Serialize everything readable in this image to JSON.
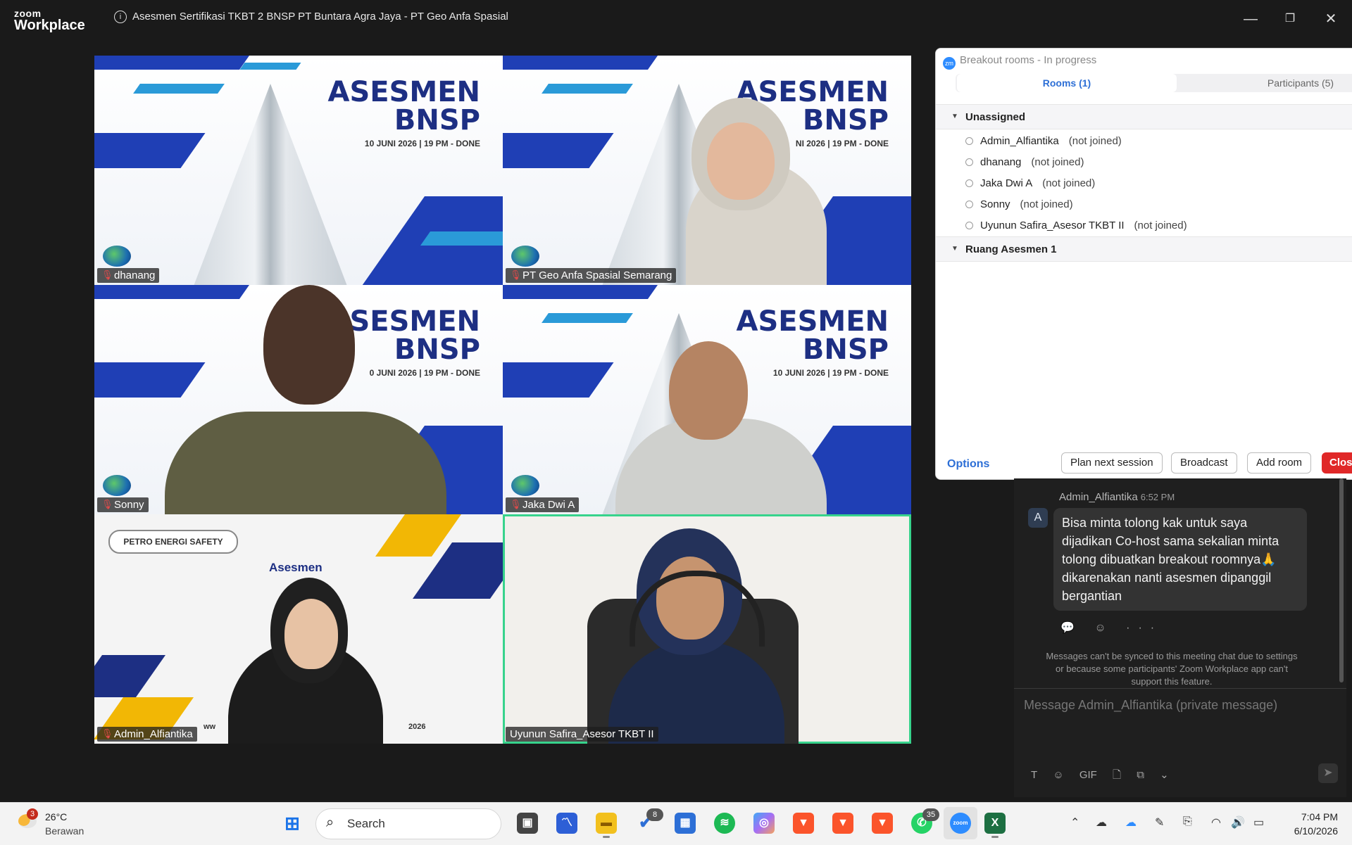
{
  "app": {
    "logo_line1": "zoom",
    "logo_line2": "Workplace",
    "window_title": "Asesmen Sertifikasi TKBT 2 BNSP PT Buntara Agra Jaya - PT Geo Anfa Spasial",
    "info_icon": "info-icon",
    "window_controls": {
      "minimize": "—",
      "restore": "❐",
      "close": "✕"
    }
  },
  "tiles": [
    {
      "name": "dhanang",
      "muted": true,
      "bg_title1": "ASESMEN",
      "bg_title2": "BNSP",
      "bg_date": "10 JUNI 2026 | 19 PM - DONE"
    },
    {
      "name": "PT Geo Anfa Spasial Semarang",
      "muted": true,
      "bg_title1": "ASESMEN",
      "bg_title2": "BNSP",
      "bg_date": "NI 2026 | 19 PM - DONE"
    },
    {
      "name": "Sonny",
      "muted": true,
      "bg_title1": "SESMEN",
      "bg_title2": "BNSP",
      "bg_date": "0 JUNI 2026 | 19 PM - DONE"
    },
    {
      "name": "Jaka Dwi A",
      "muted": true,
      "bg_title1": "ASESMEN",
      "bg_title2": "BNSP",
      "bg_date": "10 JUNI 2026 | 19 PM - DONE"
    },
    {
      "name": "Admin_Alfiantika",
      "muted": true,
      "bg_brand": "PETRO ENERGI SAFETY",
      "bg_title1": "Asesmen",
      "bg_year": "2026",
      "bg_ww": "ww"
    },
    {
      "name": "Uyunun Safira_Asesor TKBT II",
      "muted": false,
      "active_speaker": true
    }
  ],
  "breakout": {
    "header": "Breakout rooms - In progress",
    "badge": "zm",
    "tab_rooms": "Rooms (1)",
    "tab_participants": "Participants (5)",
    "sections": [
      {
        "label": "Unassigned",
        "participants": [
          {
            "name": "Admin_Alfiantika",
            "status": "(not joined)"
          },
          {
            "name": "dhanang",
            "status": "(not joined)"
          },
          {
            "name": "Jaka Dwi A",
            "status": "(not joined)"
          },
          {
            "name": "Sonny",
            "status": "(not joined)"
          },
          {
            "name": "Uyunun Safira_Asesor TKBT II",
            "status": "(not joined)"
          }
        ]
      },
      {
        "label": "Ruang Asesmen 1",
        "participants": []
      }
    ],
    "options_label": "Options",
    "btn_plan": "Plan next session",
    "btn_broadcast": "Broadcast",
    "btn_add_room": "Add room",
    "btn_close": "Clos"
  },
  "chat": {
    "sender": "Admin_Alfiantika",
    "time": "6:52 PM",
    "avatar_letter": "A",
    "message": "Bisa minta tolong kak untuk saya dijadikan Co-host sama sekalian minta tolong dibuatkan breakout roomnya🙏dikarenakan nanti asesmen dipanggil bergantian",
    "reactions": "💬 ☺ ···",
    "sync_notice": "Messages can't be synced to this meeting chat due to settings or because some participants' Zoom Workplace app can't support this feature.",
    "compose_placeholder": "Message Admin_Alfiantika (private message)",
    "tool_text": "T",
    "tool_emoji": "☺",
    "tool_gif": "GIF",
    "tool_file": "🗋",
    "tool_screenshot": "⧉",
    "tool_more": "⌄",
    "send_icon": "➤"
  },
  "taskbar": {
    "weather_badge": "3",
    "temperature": "26°C",
    "condition": "Berawan",
    "search_label": "Search",
    "todo_badge": "8",
    "whatsapp_badge": "35",
    "time": "7:04 PM",
    "date": "6/10/2026",
    "colors": {
      "windows": "#1a73e8",
      "spotify": "#1db954",
      "whatsapp": "#25d366",
      "excel": "#1d6f42",
      "zoom": "#2d8cff",
      "brave": "#fb542b"
    }
  }
}
